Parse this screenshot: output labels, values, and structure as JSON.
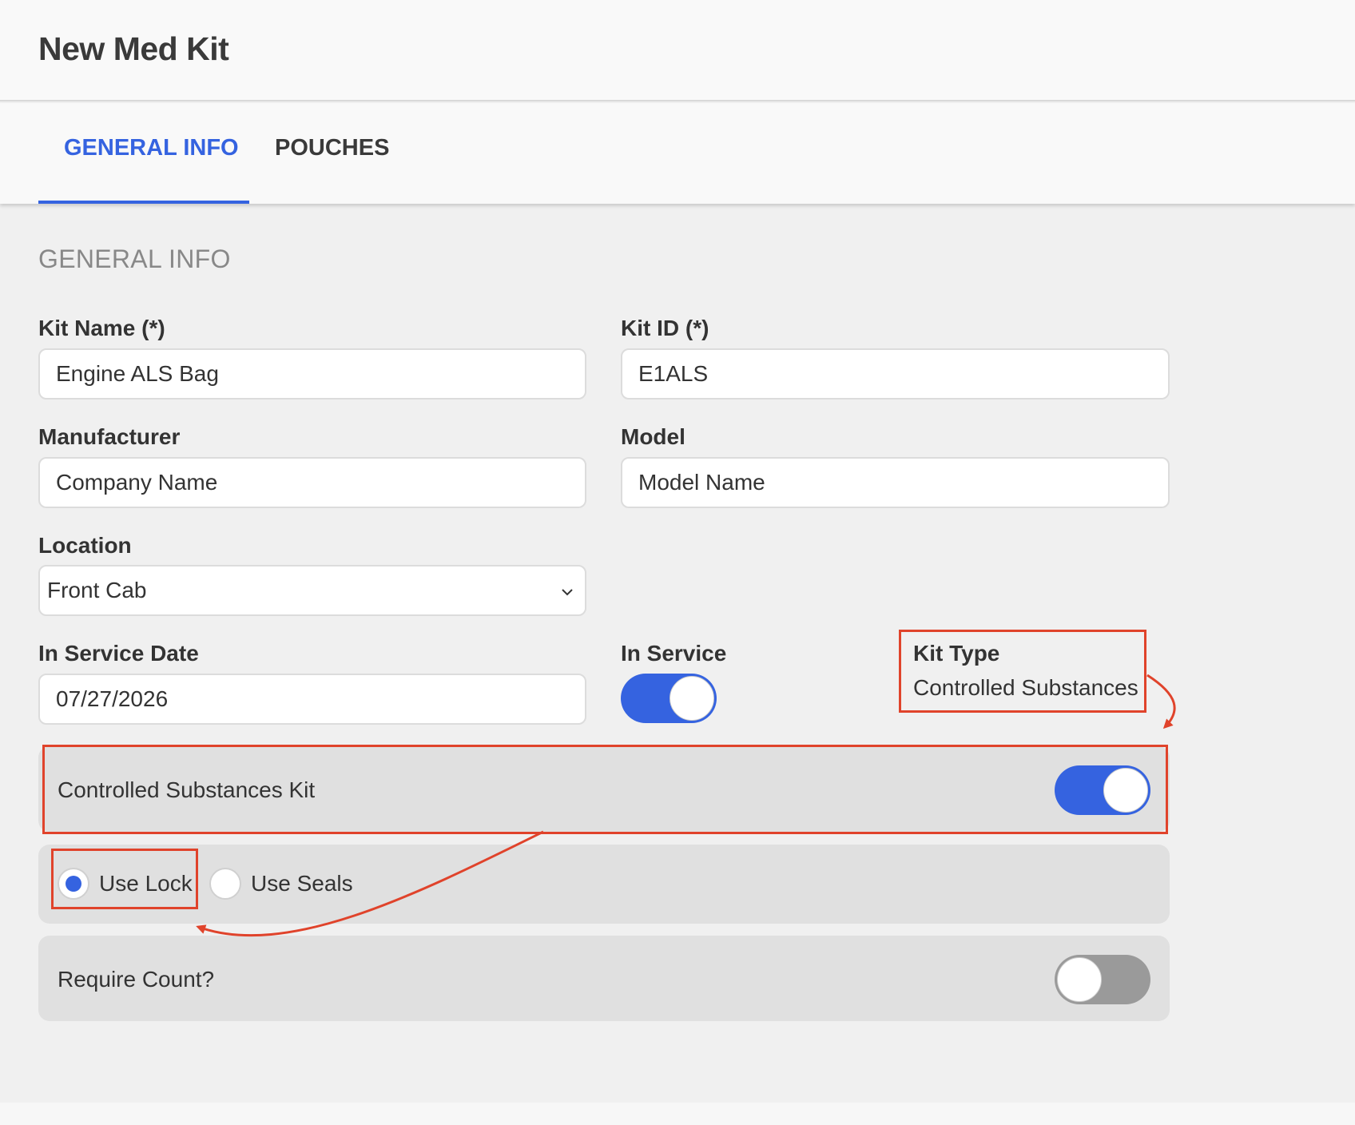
{
  "header": {
    "title": "New Med Kit"
  },
  "tabs": [
    {
      "label": "GENERAL INFO",
      "active": true
    },
    {
      "label": "POUCHES",
      "active": false
    }
  ],
  "section": {
    "title": "GENERAL INFO"
  },
  "fields": {
    "kit_name": {
      "label": "Kit Name (*)",
      "value": "Engine ALS Bag"
    },
    "kit_id": {
      "label": "Kit ID (*)",
      "value": "E1ALS"
    },
    "manufacturer": {
      "label": "Manufacturer",
      "value": "Company Name"
    },
    "model": {
      "label": "Model",
      "value": "Model Name"
    },
    "location": {
      "label": "Location",
      "value": "Front Cab"
    },
    "in_service_date": {
      "label": "In Service Date",
      "value": "07/27/2026"
    },
    "in_service": {
      "label": "In Service",
      "on": true
    },
    "kit_type": {
      "label": "Kit Type",
      "value": "Controlled Substances"
    }
  },
  "controlled_substances": {
    "label": "Controlled Substances Kit",
    "on": true
  },
  "security": {
    "options": [
      {
        "label": "Use Lock",
        "checked": true
      },
      {
        "label": "Use Seals",
        "checked": false
      }
    ]
  },
  "require_count": {
    "label": "Require Count?",
    "on": false
  },
  "colors": {
    "accent": "#3563e0",
    "annotation": "#e0432b"
  },
  "icons": {
    "select": "chevron-down-icon"
  }
}
